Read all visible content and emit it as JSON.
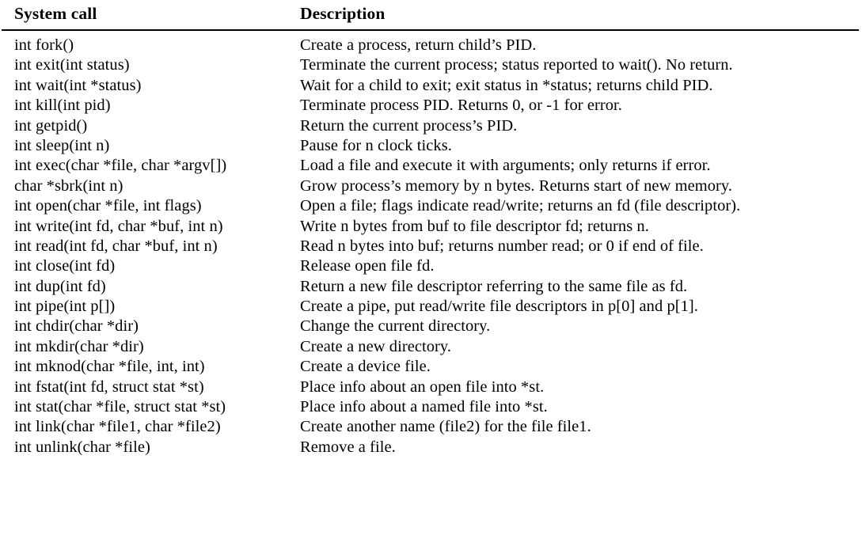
{
  "table": {
    "columns": [
      {
        "key": "call",
        "label": "System call"
      },
      {
        "key": "description",
        "label": "Description"
      }
    ],
    "rows": [
      {
        "call": "int fork()",
        "description": "Create a process, return child’s PID."
      },
      {
        "call": "int exit(int status)",
        "description": "Terminate the current process; status reported to wait(). No return."
      },
      {
        "call": "int wait(int *status)",
        "description": "Wait for a child to exit; exit status in *status; returns child PID."
      },
      {
        "call": "int kill(int pid)",
        "description": "Terminate process PID. Returns 0, or -1 for error."
      },
      {
        "call": "int getpid()",
        "description": "Return the current process’s PID."
      },
      {
        "call": "int sleep(int n)",
        "description": "Pause for n clock ticks."
      },
      {
        "call": "int exec(char *file, char *argv[])",
        "description": "Load a file and execute it with arguments; only returns if error."
      },
      {
        "call": "char *sbrk(int n)",
        "description": "Grow process’s memory by n bytes. Returns start of new memory."
      },
      {
        "call": "int open(char *file, int flags)",
        "description": "Open a file; flags indicate read/write; returns an fd (file descriptor)."
      },
      {
        "call": "int write(int fd, char *buf, int n)",
        "description": "Write n bytes from buf to file descriptor fd; returns n."
      },
      {
        "call": "int read(int fd, char *buf, int n)",
        "description": "Read n bytes into buf; returns number read; or 0 if end of file."
      },
      {
        "call": "int close(int fd)",
        "description": "Release open file fd."
      },
      {
        "call": "int dup(int fd)",
        "description": "Return a new file descriptor referring to the same file as fd."
      },
      {
        "call": "int pipe(int p[])",
        "description": "Create a pipe, put read/write file descriptors in p[0] and p[1]."
      },
      {
        "call": "int chdir(char *dir)",
        "description": "Change the current directory."
      },
      {
        "call": "int mkdir(char *dir)",
        "description": "Create a new directory."
      },
      {
        "call": "int mknod(char *file, int, int)",
        "description": "Create a device file."
      },
      {
        "call": "int fstat(int fd, struct stat *st)",
        "description": "Place info about an open file into *st."
      },
      {
        "call": "int stat(char *file, struct stat *st)",
        "description": "Place info about a named file into *st."
      },
      {
        "call": "int link(char *file1, char *file2)",
        "description": "Create another name (file2) for the file file1."
      },
      {
        "call": "int unlink(char *file)",
        "description": "Remove a file."
      }
    ]
  }
}
